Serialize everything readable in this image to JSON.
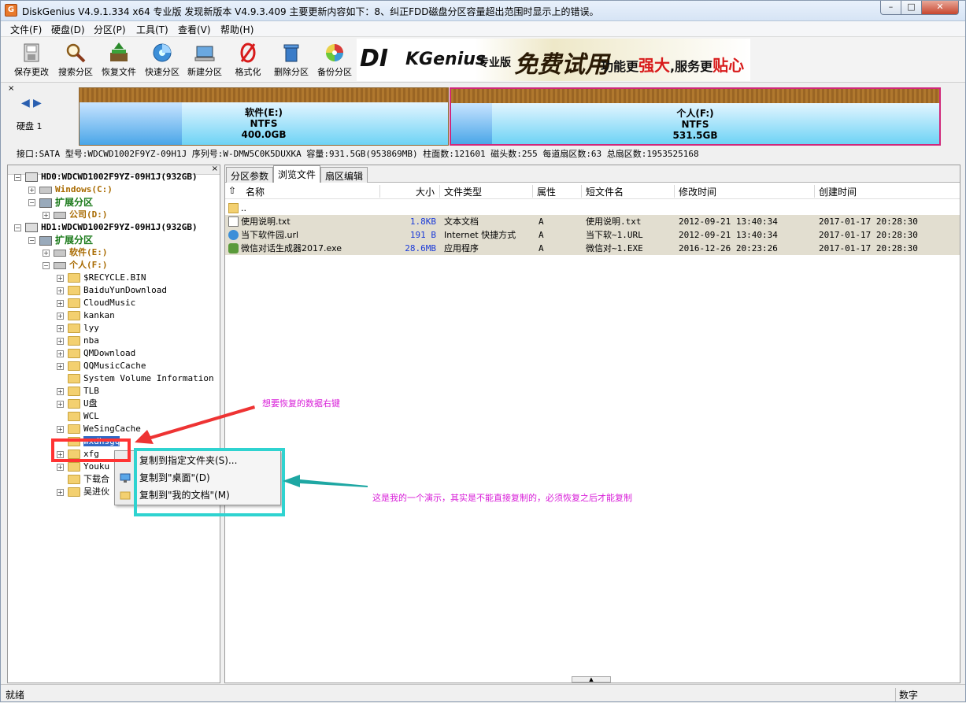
{
  "app": {
    "title": "DiskGenius V4.9.1.334 x64 专业版  发现新版本 V4.9.3.409 主要更新内容如下：8、纠正FDD磁盘分区容量超出范围时显示上的错误。",
    "icon_letter": "G"
  },
  "window_controls": {
    "minimize": "–",
    "restore": "□",
    "close": "✕"
  },
  "menu": [
    "文件(F)",
    "硬盘(D)",
    "分区(P)",
    "工具(T)",
    "查看(V)",
    "帮助(H)"
  ],
  "toolbar": [
    {
      "label": "保存更改",
      "icon": "save-icon"
    },
    {
      "label": "搜索分区",
      "icon": "search-icon"
    },
    {
      "label": "恢复文件",
      "icon": "recover-icon"
    },
    {
      "label": "快速分区",
      "icon": "quick-partition-icon"
    },
    {
      "label": "新建分区",
      "icon": "new-partition-icon"
    },
    {
      "label": "格式化",
      "icon": "format-icon"
    },
    {
      "label": "删除分区",
      "icon": "delete-icon"
    },
    {
      "label": "备份分区",
      "icon": "backup-icon"
    }
  ],
  "banner": {
    "brand_a": "DI",
    "brand_b": "KGenius",
    "edition": "专业版",
    "trial": "免费试用",
    "slogan_a": "功能更",
    "slogan_b": "强大",
    "slogan_c": ",服务更",
    "slogan_d": "贴心"
  },
  "disk": {
    "label": "硬盘 1",
    "partitions": [
      {
        "name": "软件(E:)",
        "fs": "NTFS",
        "size": "400.0GB"
      },
      {
        "name": "个人(F:)",
        "fs": "NTFS",
        "size": "531.5GB"
      }
    ],
    "info": "接口:SATA  型号:WDCWD1002F9YZ-09H1J  序列号:W-DMW5C0K5DUXKA  容量:931.5GB(953869MB)  柱面数:121601  磁头数:255  每道扇区数:63  总扇区数:1953525168"
  },
  "tree": [
    {
      "label": "HD0:WDCWD1002F9YZ-09H1J(932GB)",
      "kind": "disk"
    },
    {
      "label": "Windows(C:)",
      "kind": "drive"
    },
    {
      "label": "扩展分区",
      "kind": "ext"
    },
    {
      "label": "公司(D:)",
      "kind": "drive"
    },
    {
      "label": "HD1:WDCWD1002F9YZ-09H1J(932GB)",
      "kind": "disk"
    },
    {
      "label": "扩展分区",
      "kind": "ext"
    },
    {
      "label": "软件(E:)",
      "kind": "drive"
    },
    {
      "label": "个人(F:)",
      "kind": "drive"
    },
    {
      "label": "$RECYCLE.BIN",
      "kind": "folder"
    },
    {
      "label": "BaiduYunDownload",
      "kind": "folder"
    },
    {
      "label": "CloudMusic",
      "kind": "folder"
    },
    {
      "label": "kankan",
      "kind": "folder"
    },
    {
      "label": "lyy",
      "kind": "folder"
    },
    {
      "label": "nba",
      "kind": "folder"
    },
    {
      "label": "QMDownload",
      "kind": "folder"
    },
    {
      "label": "QQMusicCache",
      "kind": "folder"
    },
    {
      "label": "System Volume Information",
      "kind": "folder"
    },
    {
      "label": "TLB",
      "kind": "folder"
    },
    {
      "label": "U盘",
      "kind": "folder"
    },
    {
      "label": "WCL",
      "kind": "folder"
    },
    {
      "label": "WeSingCache",
      "kind": "folder"
    },
    {
      "label": "wxdhsgq",
      "kind": "folder"
    },
    {
      "label": "xfg",
      "kind": "folder"
    },
    {
      "label": "Youku",
      "kind": "folder"
    },
    {
      "label": "下载合",
      "kind": "folder"
    },
    {
      "label": "吴进伙",
      "kind": "folder"
    }
  ],
  "tabs": [
    "分区参数",
    "浏览文件",
    "扇区编辑"
  ],
  "columns": [
    "名称",
    "大小",
    "文件类型",
    "属性",
    "短文件名",
    "修改时间",
    "创建时间"
  ],
  "files": [
    {
      "name": "..",
      "size": "",
      "type": "",
      "attr": "",
      "short": "",
      "modified": "",
      "created": ""
    },
    {
      "name": "使用说明.txt",
      "size": "1.8KB",
      "type": "文本文档",
      "attr": "A",
      "short": "使用说明.txt",
      "modified": "2012-09-21 13:40:34",
      "created": "2017-01-17 20:28:30"
    },
    {
      "name": "当下软件园.url",
      "size": "191 B",
      "type": "Internet 快捷方式",
      "attr": "A",
      "short": "当下软~1.URL",
      "modified": "2012-09-21 13:40:34",
      "created": "2017-01-17 20:28:30"
    },
    {
      "name": "微信对话生成器2017.exe",
      "size": "28.6MB",
      "type": "应用程序",
      "attr": "A",
      "short": "微信对~1.EXE",
      "modified": "2016-12-26 20:23:26",
      "created": "2017-01-17 20:28:30"
    }
  ],
  "context_menu": [
    "复制到指定文件夹(S)...",
    "复制到\"桌面\"(D)",
    "复制到\"我的文档\"(M)"
  ],
  "annotations": {
    "note1": "想要恢复的数据右键",
    "note2": "这是我的一个演示，其实是不能直接复制的，必须恢复之后才能复制"
  },
  "status": {
    "left": "就绪",
    "right": "数字"
  },
  "colors": {
    "annotation_text": "#d81ed8",
    "red_box": "#ff3333",
    "cyan_box": "#2fd3d0",
    "partition_f_border": "#d0287a"
  }
}
